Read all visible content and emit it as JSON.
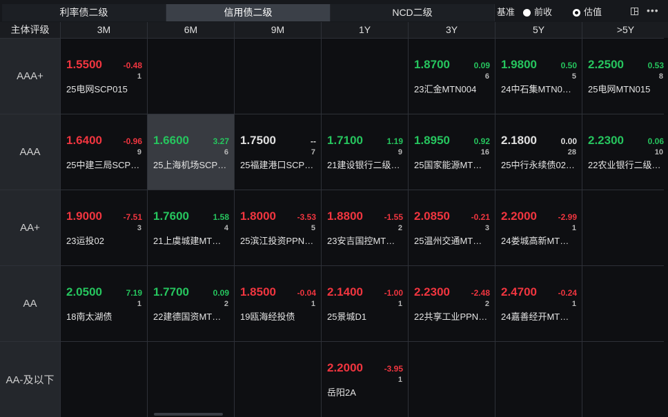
{
  "tabs": [
    "利率债二级",
    "信用债二级",
    "NCD二级"
  ],
  "active_tab": 1,
  "basis": {
    "label": "基准",
    "options": [
      "前收",
      "估值"
    ],
    "selected": 1
  },
  "columns": [
    "主体评级",
    "3M",
    "6M",
    "9M",
    "1Y",
    "3Y",
    "5Y",
    ">5Y"
  ],
  "rows": [
    {
      "rating": "AAA+",
      "cells": [
        {
          "yield": "1.5500",
          "change": "-0.48",
          "count": "1",
          "bond": "25电网SCP015",
          "color": "up"
        },
        null,
        null,
        null,
        {
          "yield": "1.8700",
          "change": "0.09",
          "count": "6",
          "bond": "23汇金MTN004",
          "color": "down"
        },
        {
          "yield": "1.9800",
          "change": "0.50",
          "count": "5",
          "bond": "24中石集MTN0…",
          "color": "down"
        },
        {
          "yield": "2.2500",
          "change": "0.53",
          "count": "8",
          "bond": "25电网MTN015",
          "color": "down"
        }
      ]
    },
    {
      "rating": "AAA",
      "cells": [
        {
          "yield": "1.6400",
          "change": "-0.96",
          "count": "9",
          "bond": "25中建三局SCP…",
          "color": "up"
        },
        {
          "yield": "1.6600",
          "change": "3.27",
          "count": "6",
          "bond": "25上海机场SCP…",
          "color": "down",
          "selected": true
        },
        {
          "yield": "1.7500",
          "change": "--",
          "count": "7",
          "bond": "25福建港口SCP…",
          "color": "flat"
        },
        {
          "yield": "1.7100",
          "change": "1.19",
          "count": "9",
          "bond": "21建设银行二级…",
          "color": "down"
        },
        {
          "yield": "1.8950",
          "change": "0.92",
          "count": "16",
          "bond": "25国家能源MT…",
          "color": "down"
        },
        {
          "yield": "2.1800",
          "change": "0.00",
          "count": "28",
          "bond": "25中行永续债02…",
          "color": "flat"
        },
        {
          "yield": "2.2300",
          "change": "0.06",
          "count": "10",
          "bond": "22农业银行二级…",
          "color": "down"
        }
      ]
    },
    {
      "rating": "AA+",
      "cells": [
        {
          "yield": "1.9000",
          "change": "-7.51",
          "count": "3",
          "bond": "23运投02",
          "color": "up"
        },
        {
          "yield": "1.7600",
          "change": "1.58",
          "count": "4",
          "bond": "21上虞城建MT…",
          "color": "down"
        },
        {
          "yield": "1.8000",
          "change": "-3.53",
          "count": "5",
          "bond": "25滨江投资PPN…",
          "color": "up"
        },
        {
          "yield": "1.8800",
          "change": "-1.55",
          "count": "2",
          "bond": "23安吉国控MT…",
          "color": "up"
        },
        {
          "yield": "2.0850",
          "change": "-0.21",
          "count": "3",
          "bond": "25温州交通MT…",
          "color": "up"
        },
        {
          "yield": "2.2000",
          "change": "-2.99",
          "count": "1",
          "bond": "24娄城高新MT…",
          "color": "up"
        },
        null
      ]
    },
    {
      "rating": "AA",
      "cells": [
        {
          "yield": "2.0500",
          "change": "7.19",
          "count": "1",
          "bond": "18南太湖债",
          "color": "down"
        },
        {
          "yield": "1.7700",
          "change": "0.09",
          "count": "2",
          "bond": "22建德国资MT…",
          "color": "down"
        },
        {
          "yield": "1.8500",
          "change": "-0.04",
          "count": "1",
          "bond": "19瓯海经投债",
          "color": "up"
        },
        {
          "yield": "2.1400",
          "change": "-1.00",
          "count": "1",
          "bond": "25景城D1",
          "color": "up"
        },
        {
          "yield": "2.2300",
          "change": "-2.48",
          "count": "2",
          "bond": "22共享工业PPN…",
          "color": "up"
        },
        {
          "yield": "2.4700",
          "change": "-0.24",
          "count": "1",
          "bond": "24嘉善经开MT…",
          "color": "up"
        },
        null
      ]
    },
    {
      "rating": "AA-及以下",
      "cells": [
        null,
        null,
        null,
        {
          "yield": "2.2000",
          "change": "-3.95",
          "count": "1",
          "bond": "岳阳2A",
          "color": "up"
        },
        null,
        null,
        null
      ]
    }
  ]
}
